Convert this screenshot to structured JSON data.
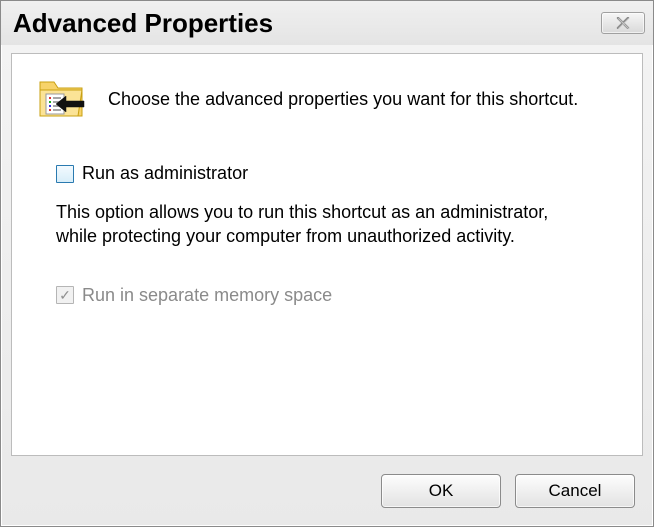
{
  "window": {
    "title": "Advanced Properties"
  },
  "intro": "Choose the advanced properties you want for this shortcut.",
  "options": {
    "runAsAdmin": {
      "label": "Run as administrator",
      "checked": false,
      "help": "This option allows you to run this shortcut as an administrator, while protecting your computer from unauthorized activity."
    },
    "separateMemory": {
      "label": "Run in separate memory space",
      "checked": true,
      "disabled": true
    }
  },
  "buttons": {
    "ok": "OK",
    "cancel": "Cancel"
  }
}
